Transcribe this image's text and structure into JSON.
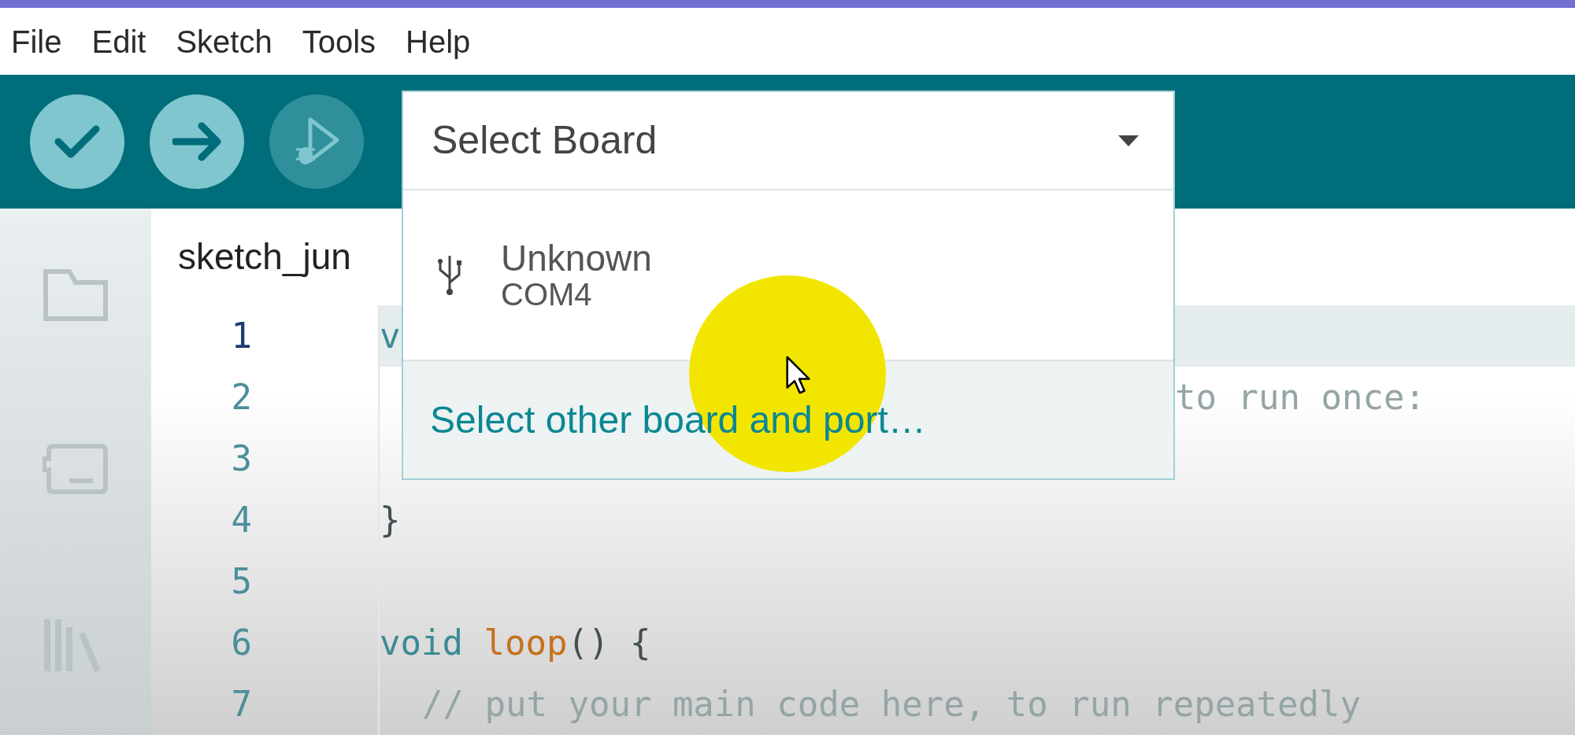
{
  "menu": [
    "File",
    "Edit",
    "Sketch",
    "Tools",
    "Help"
  ],
  "toolbar": [
    {
      "kind": "verify",
      "disabled": false
    },
    {
      "kind": "upload",
      "disabled": false
    },
    {
      "kind": "debug",
      "disabled": true
    }
  ],
  "board_selector": {
    "label": "Select Board",
    "ports": [
      {
        "name": "Unknown",
        "port": "COM4"
      }
    ],
    "footer": "Select other board and port…"
  },
  "sidebar": [
    {
      "kind": "folder"
    },
    {
      "kind": "board"
    },
    {
      "kind": "library"
    }
  ],
  "tab": {
    "label": "sketch_jun"
  },
  "code_lines": [
    {
      "number": "1",
      "highlighted": true,
      "tokens": [
        {
          "kind": "keyword",
          "text": "v"
        }
      ]
    },
    {
      "number": "2",
      "highlighted": false,
      "covered": true,
      "tokens": [
        {
          "kind": "comment",
          "text": "to run once:"
        }
      ]
    },
    {
      "number": "3",
      "highlighted": false
    },
    {
      "number": "4",
      "highlighted": false,
      "tokens": [
        {
          "kind": "plain",
          "text": "}"
        }
      ]
    },
    {
      "number": "5",
      "highlighted": false
    },
    {
      "number": "6",
      "highlighted": false,
      "tokens": [
        {
          "kind": "keyword",
          "text": "void"
        },
        {
          "kind": "space"
        },
        {
          "kind": "function",
          "text": "loop"
        },
        {
          "kind": "plain",
          "text": "() {"
        }
      ]
    },
    {
      "number": "7",
      "highlighted": false,
      "indented": true,
      "tokens": [
        {
          "kind": "comment",
          "text": "// put your main code here, to run repeatedly"
        }
      ]
    }
  ]
}
